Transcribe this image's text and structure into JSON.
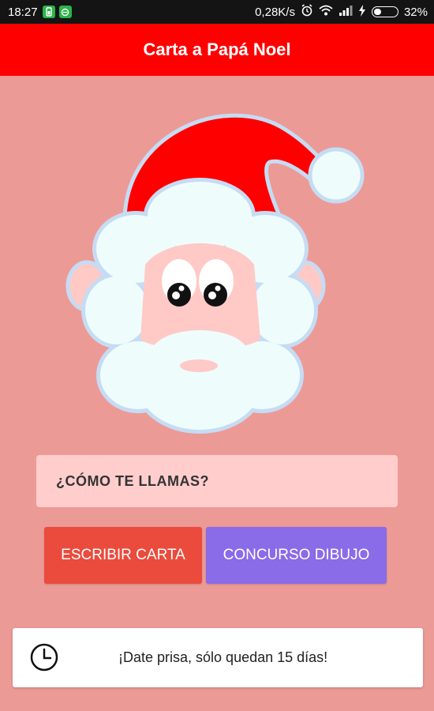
{
  "status_bar": {
    "time": "18:27",
    "network_speed": "0,28K/s",
    "battery_percent": "32%",
    "battery_level": 0.32,
    "icons": [
      "battery-saver-icon",
      "chat-icon",
      "alarm-icon",
      "wifi-icon",
      "signal-icon",
      "charging-icon",
      "battery-icon"
    ]
  },
  "app_bar": {
    "title": "Carta a Papá Noel"
  },
  "illustration": {
    "name": "santa-face-illustration"
  },
  "name_input": {
    "placeholder": "¿CÓMO TE LLAMAS?"
  },
  "buttons": {
    "write_letter": "ESCRIBIR CARTA",
    "drawing_contest": "CONCURSO DIBUJO"
  },
  "countdown": {
    "icon": "clock-icon",
    "text": "¡Date prisa, sólo quedan 15 días!"
  },
  "colors": {
    "app_bar": "#ff0000",
    "background": "#ec9a96",
    "write_button": "#ea4b3c",
    "drawing_button": "#8a6be8"
  }
}
